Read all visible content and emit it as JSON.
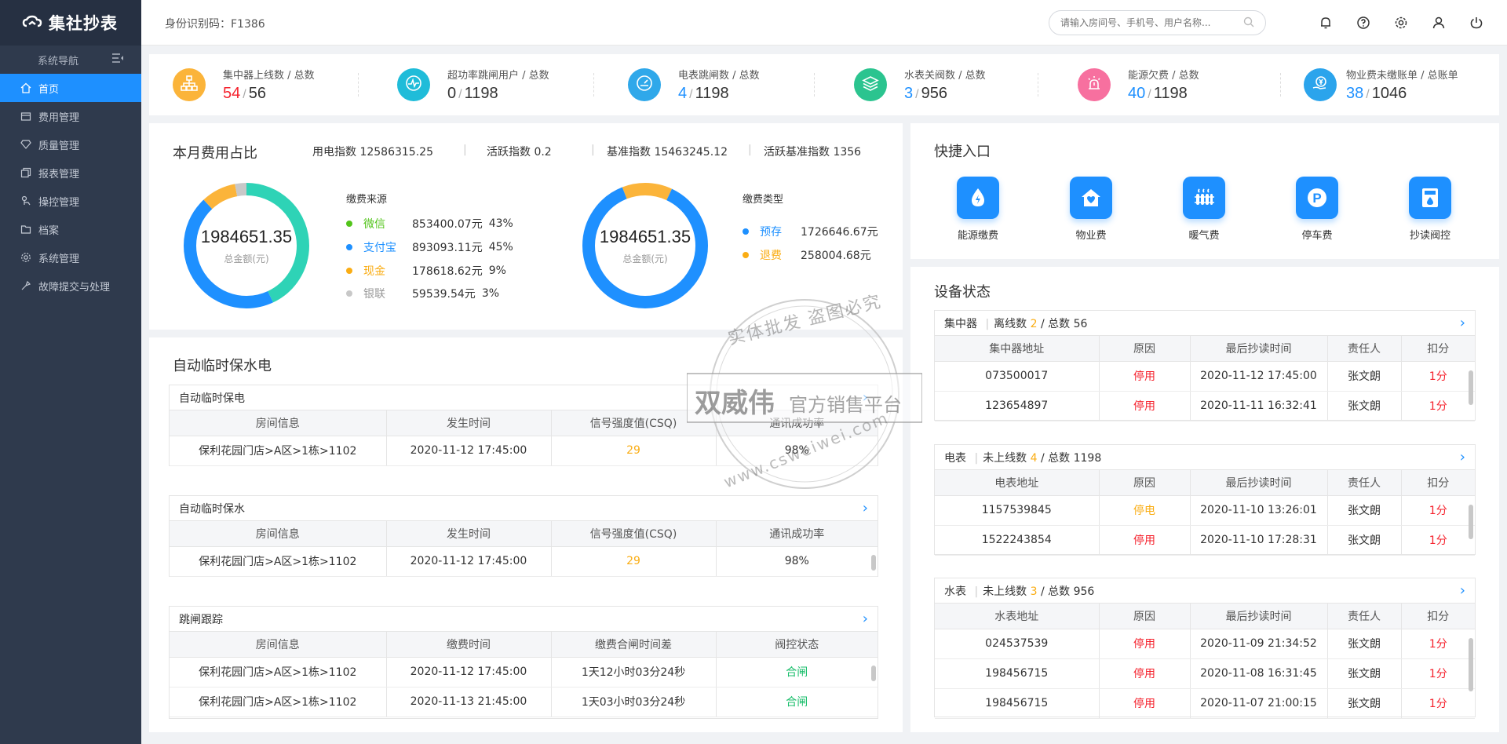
{
  "sidebar": {
    "logo": "集社抄表",
    "nav_title": "系统导航",
    "items": [
      {
        "label": "首页",
        "icon": "home-icon"
      },
      {
        "label": "费用管理",
        "icon": "wallet-icon"
      },
      {
        "label": "质量管理",
        "icon": "diamond-icon"
      },
      {
        "label": "报表管理",
        "icon": "copy-icon"
      },
      {
        "label": "操控管理",
        "icon": "control-icon"
      },
      {
        "label": "档案",
        "icon": "folder-icon"
      },
      {
        "label": "系统管理",
        "icon": "gear-icon"
      },
      {
        "label": "故障提交与处理",
        "icon": "fault-icon"
      }
    ]
  },
  "header": {
    "id_code": "身份识别码：F1386",
    "search_placeholder": "请输入房间号、手机号、用户名称..."
  },
  "stats": [
    {
      "label": "集中器上线数 / 总数",
      "value": "54",
      "total": "56",
      "value_color": "#f5222d",
      "icon_color": "#fbb43a"
    },
    {
      "label": "超功率跳闸用户 / 总数",
      "value": "0",
      "total": "1198",
      "value_color": "#333333",
      "icon_color": "#1fbcd9"
    },
    {
      "label": "电表跳闸数 / 总数",
      "value": "4",
      "total": "1198",
      "value_color": "#1e90ff",
      "icon_color": "#2fa8ea"
    },
    {
      "label": "水表关阀数 / 总数",
      "value": "3",
      "total": "956",
      "value_color": "#1e90ff",
      "icon_color": "#2bc48f"
    },
    {
      "label": "能源欠费 / 总数",
      "value": "40",
      "total": "1198",
      "value_color": "#1e90ff",
      "icon_color": "#f7709f"
    },
    {
      "label": "物业费未缴账单 / 总账单",
      "value": "38",
      "total": "1046",
      "value_color": "#1e90ff",
      "icon_color": "#2ba4ec"
    }
  ],
  "fee": {
    "title": "本月费用占比",
    "indices": [
      "用电指数 12586315.25",
      "活跃指数 0.2",
      "基准指数 15463245.12",
      "活跃基准指数 1356"
    ],
    "donut1": {
      "total": "1984651.35",
      "caption": "总金额(元)",
      "legend_title": "缴费来源",
      "items": [
        {
          "name": "微信",
          "amount": "853400.07元",
          "pct": "43%",
          "value": 43,
          "color": "#2ed3b6",
          "name_color": "#52c41a"
        },
        {
          "name": "支付宝",
          "amount": "893093.11元",
          "pct": "45%",
          "value": 45,
          "color": "#1e90ff",
          "name_color": "#1e90ff"
        },
        {
          "name": "现金",
          "amount": "178618.62元",
          "pct": "9%",
          "value": 9,
          "color": "#fbb43a",
          "name_color": "#faad14"
        },
        {
          "name": "银联",
          "amount": "59539.54元",
          "pct": "3%",
          "value": 3,
          "color": "#c8c8c8",
          "name_color": "#999999"
        }
      ]
    },
    "donut2": {
      "total": "1984651.35",
      "caption": "总金额(元)",
      "legend_title": "缴费类型",
      "items": [
        {
          "name": "预存",
          "amount": "1726646.67元",
          "value": 87,
          "color": "#1e90ff",
          "name_color": "#1e90ff"
        },
        {
          "name": "退费",
          "amount": "258004.68元",
          "value": 13,
          "color": "#fbb43a",
          "name_color": "#faad14"
        }
      ]
    }
  },
  "quick": {
    "title": "快捷入口",
    "items": [
      {
        "label": "能源缴费",
        "icon": "energy-drop-icon"
      },
      {
        "label": "物业费",
        "icon": "house-heart-icon"
      },
      {
        "label": "暖气费",
        "icon": "radiator-icon"
      },
      {
        "label": "停车费",
        "icon": "parking-icon"
      },
      {
        "label": "抄读阀控",
        "icon": "meter-icon"
      }
    ]
  },
  "auto": {
    "title": "自动临时保水电",
    "power": {
      "title": "自动临时保电",
      "headers": [
        "房间信息",
        "发生时间",
        "信号强度值(CSQ)",
        "通讯成功率"
      ],
      "rows": [
        [
          "保利花园门店>A区>1栋>1102",
          "2020-11-12 17:45:00",
          "29",
          "98%"
        ]
      ]
    },
    "water": {
      "title": "自动临时保水",
      "headers": [
        "房间信息",
        "发生时间",
        "信号强度值(CSQ)",
        "通讯成功率"
      ],
      "rows": [
        [
          "保利花园门店>A区>1栋>1102",
          "2020-11-12 17:45:00",
          "29",
          "98%"
        ]
      ]
    },
    "trip": {
      "title": "跳闸跟踪",
      "headers": [
        "房间信息",
        "缴费时间",
        "缴费合闸时间差",
        "阀控状态"
      ],
      "rows": [
        [
          "保利花园门店>A区>1栋>1102",
          "2020-11-12 17:45:00",
          "1天12小时03分24秒",
          "合闸"
        ],
        [
          "保利花园门店>A区>1栋>1102",
          "2020-11-13 21:45:00",
          "1天03小时03分24秒",
          "合闸"
        ]
      ]
    }
  },
  "device": {
    "title": "设备状态",
    "concentrator": {
      "name": "集中器",
      "sep": "|",
      "metric": "离线数",
      "count": "2",
      "total_label": "/ 总数 56",
      "headers": [
        "集中器地址",
        "原因",
        "最后抄读时间",
        "责任人",
        "扣分"
      ],
      "rows": [
        [
          "073500017",
          "停用",
          "2020-11-12 17:45:00",
          "张文朗",
          "1分"
        ],
        [
          "123654897",
          "停用",
          "2020-11-11 16:32:41",
          "张文朗",
          "1分"
        ]
      ]
    },
    "meter": {
      "name": "电表",
      "sep": "|",
      "metric": "未上线数",
      "count": "4",
      "total_label": "/ 总数 1198",
      "headers": [
        "电表地址",
        "原因",
        "最后抄读时间",
        "责任人",
        "扣分"
      ],
      "rows": [
        [
          "1157539845",
          "停电",
          "2020-11-10 13:26:01",
          "张文朗",
          "1分"
        ],
        [
          "1522243854",
          "停用",
          "2020-11-10 17:28:31",
          "张文朗",
          "1分"
        ]
      ]
    },
    "water": {
      "name": "水表",
      "sep": "|",
      "metric": "未上线数",
      "count": "3",
      "total_label": "/ 总数 956",
      "headers": [
        "水表地址",
        "原因",
        "最后抄读时间",
        "责任人",
        "扣分"
      ],
      "rows": [
        [
          "024537539",
          "停用",
          "2020-11-09 21:34:52",
          "张文朗",
          "1分"
        ],
        [
          "198456715",
          "停用",
          "2020-11-08 16:31:45",
          "张文朗",
          "1分"
        ],
        [
          "198456715",
          "停用",
          "2020-11-07 21:00:15",
          "张文朗",
          "1分"
        ]
      ]
    }
  },
  "watermark": {
    "top": "实体批发 盗图必究",
    "middle": "双威伟",
    "middle_sub": "官方销售平台",
    "bottom": "www.csweiwei.com"
  }
}
